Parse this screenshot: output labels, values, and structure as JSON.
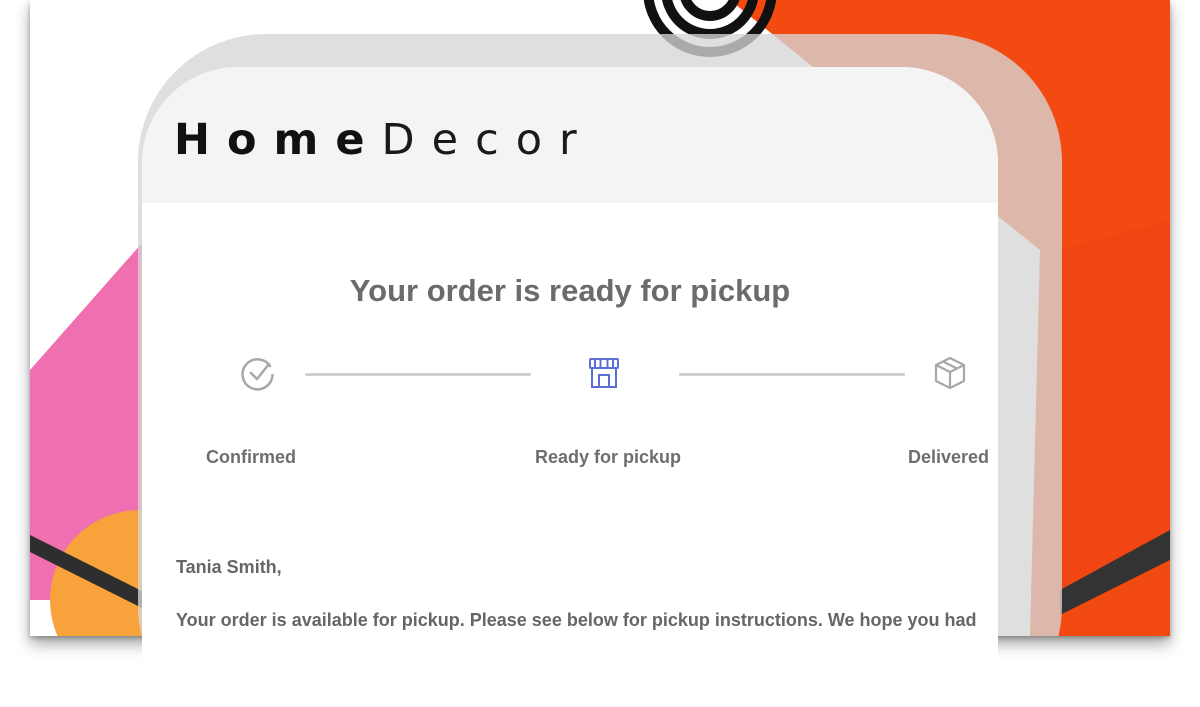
{
  "brand": {
    "logo_bold": "Home",
    "logo_regular": "Decor"
  },
  "email": {
    "headline": "Your order is ready for pickup",
    "steps": [
      {
        "label": "Confirmed",
        "icon": "check-circle-icon",
        "state": "done"
      },
      {
        "label": "Ready for pickup",
        "icon": "storefront-icon",
        "state": "current"
      },
      {
        "label": "Delivered",
        "icon": "package-box-icon",
        "state": "pending"
      }
    ],
    "greeting": "Tania Smith,",
    "body": "Your order is available for pickup. Please see below for pickup instructions. We hope you had"
  },
  "colors": {
    "accent_blue": "#5b6fd6",
    "muted_gray": "#a8a8a8",
    "background_orange": "#f24a10",
    "background_pink": "#ef6fb0"
  }
}
